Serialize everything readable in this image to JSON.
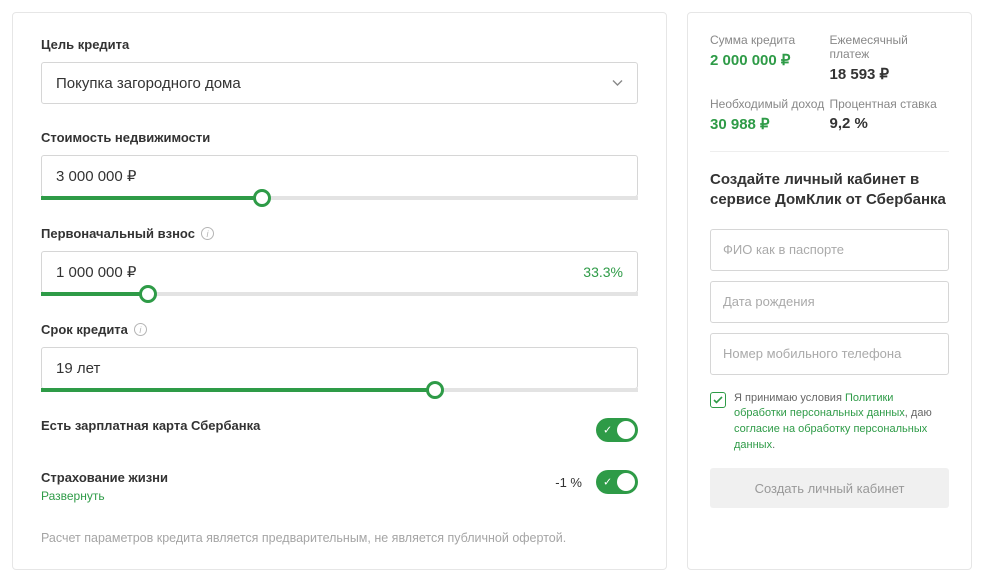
{
  "left": {
    "purpose": {
      "label": "Цель кредита",
      "value": "Покупка загородного дома"
    },
    "property_cost": {
      "label": "Стоимость недвижимости",
      "value": "3 000 000 ₽",
      "fill": 37
    },
    "down_payment": {
      "label": "Первоначальный взнос",
      "value": "1 000 000 ₽",
      "percent": "33.3%",
      "fill": 18
    },
    "term": {
      "label": "Срок кредита",
      "value": "19 лет",
      "fill": 66
    },
    "salary_card": {
      "label": "Есть зарплатная карта Сбербанка"
    },
    "life_insurance": {
      "label": "Страхование жизни",
      "expand": "Развернуть",
      "value": "-1 %"
    },
    "disclaimer": "Расчет параметров кредита является предварительным, не является публичной офертой."
  },
  "right": {
    "summary": {
      "loan_amount": {
        "label": "Сумма кредита",
        "value": "2 000 000 ₽"
      },
      "monthly_payment": {
        "label": "Ежемесячный платеж",
        "value": "18 593 ₽"
      },
      "required_income": {
        "label": "Необходимый доход",
        "value": "30 988 ₽"
      },
      "interest_rate": {
        "label": "Процентная ставка",
        "value": "9,2 %"
      }
    },
    "form": {
      "heading": "Создайте личный кабинет в сервисе ДомКлик от Сбербанка",
      "name_placeholder": "ФИО как в паспорте",
      "dob_placeholder": "Дата рождения",
      "phone_placeholder": "Номер мобильного телефона",
      "consent_prefix": "Я принимаю условия ",
      "consent_link1": "Политики обработки персональных данных",
      "consent_mid": ", даю ",
      "consent_link2": "согласие на обработку персональных данных",
      "consent_suffix": ".",
      "submit": "Создать личный кабинет"
    }
  }
}
